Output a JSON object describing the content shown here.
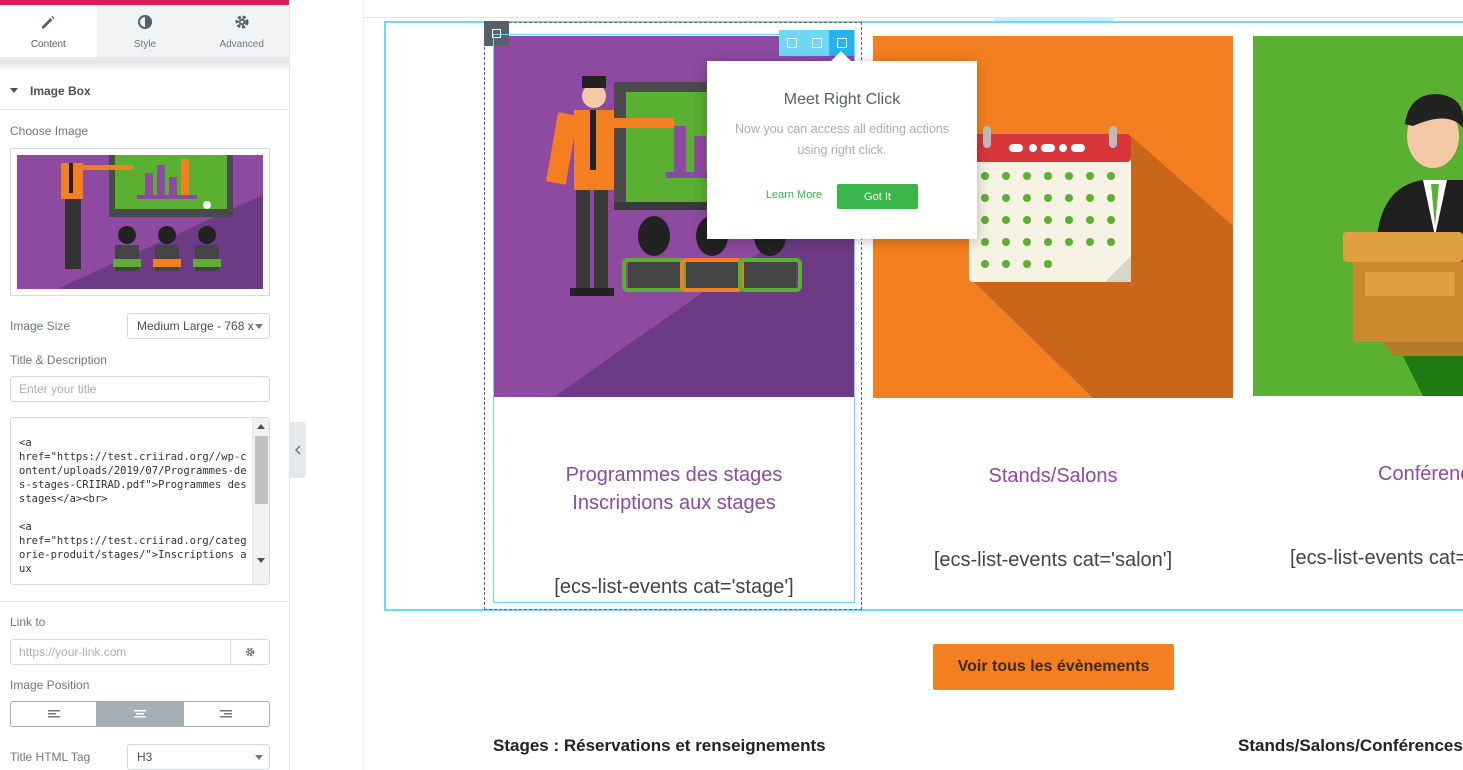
{
  "editor": {
    "tabs": [
      {
        "label": "Content",
        "icon": "pencil-icon",
        "active": true
      },
      {
        "label": "Style",
        "icon": "half-circle-icon",
        "active": false
      },
      {
        "label": "Advanced",
        "icon": "gear-icon",
        "active": false
      }
    ],
    "section_title": "Image Box",
    "choose_image_label": "Choose Image",
    "image_size_label": "Image Size",
    "image_size_value": "Medium Large - 768 x",
    "title_desc_label": "Title & Description",
    "title_placeholder": "Enter your title",
    "description_value": "<a\nhref=\"https://test.criirad.org//wp-content/uploads/2019/07/Programmes-des-stages-CRIIRAD.pdf\">Programmes des stages</a><br>\n\n<a\nhref=\"https://test.criirad.org/categorie-produit/stages/\">Inscriptions aux",
    "link_label": "Link to",
    "link_placeholder": "https://your-link.com",
    "image_position_label": "Image Position",
    "title_tag_label": "Title HTML Tag",
    "title_tag_value": "H3"
  },
  "popup": {
    "title": "Meet Right Click",
    "text": "Now you can access all editing actions using right click.",
    "learn_more": "Learn More",
    "got_it": "Got It"
  },
  "cards": [
    {
      "title_line1": "Programmes des stages",
      "title_line2": "Inscriptions aux stages",
      "shortcode": "[ecs-list-events cat='stage']",
      "bg": "#8e4aa0"
    },
    {
      "title_line1": "Stands/Salons",
      "title_line2": "",
      "shortcode": "[ecs-list-events cat='salon']",
      "bg": "#f47f20"
    },
    {
      "title_line1": "Conférenc",
      "title_line2": "",
      "shortcode": "[ecs-list-events cat=",
      "bg": "#5ab031"
    }
  ],
  "cta_label": "Voir tous les évènements",
  "footer": {
    "left_heading": "Stages : Réservations et renseignements",
    "right_heading": "Stands/Salons/Conférences"
  },
  "colors": {
    "accent": "#d5205a",
    "editor_blue": "#71d7f7",
    "green": "#39b54a",
    "orange": "#f47f20",
    "purple": "#8e4aa0"
  }
}
